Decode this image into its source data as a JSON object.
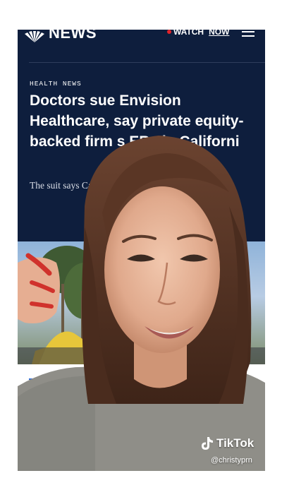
{
  "news": {
    "logo_text": "NEWS",
    "watch_label": "WATCH",
    "watch_now": "NOW",
    "kicker": "HEALTH NEWS",
    "headline": "Doctors sue Envision Healthcare, say private equity-backed firm s      ERs in Californi",
    "dek": "The suit says Ca practicing me but haven't in",
    "lower_letter": "H"
  },
  "tiktok": {
    "brand": "TikTok",
    "handle": "@christyprn"
  },
  "colors": {
    "navy": "#0e1e3d",
    "live_red": "#e2242a",
    "accent_blue": "#2a6ad8"
  },
  "icons": [
    "peacock-logo-icon",
    "hamburger-menu-icon",
    "tiktok-logo-icon"
  ]
}
